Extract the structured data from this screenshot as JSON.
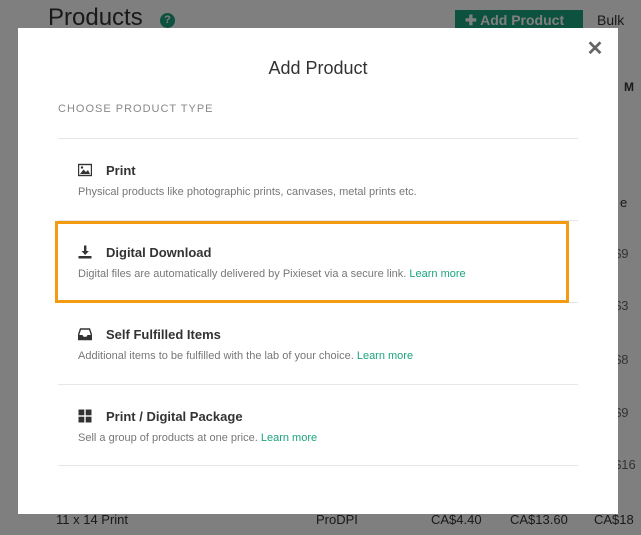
{
  "background": {
    "page_title": "Products",
    "help_icon": "?",
    "add_product_label": "Add Product",
    "bulk_label": "Bulk",
    "column_header": "M",
    "column_fragment": "e",
    "side_values": [
      "$9",
      "$3",
      "$8",
      "$9",
      "$16"
    ],
    "last_row": {
      "name": "11 x 14 Print",
      "lab": "ProDPI",
      "cost": "CA$4.40",
      "price": "CA$13.60",
      "extra": "CA$18"
    }
  },
  "modal": {
    "title": "Add Product",
    "close_glyph": "✕",
    "section_label": "CHOOSE PRODUCT TYPE",
    "options": [
      {
        "icon": "image-icon",
        "title": "Print",
        "desc": "Physical products like photographic prints, canvases, metal prints etc.",
        "link": ""
      },
      {
        "icon": "download-icon",
        "title": "Digital Download",
        "desc": "Digital files are automatically delivered by Pixieset via a secure link.",
        "link": "Learn more"
      },
      {
        "icon": "inbox-icon",
        "title": "Self Fulfilled Items",
        "desc": "Additional items to be fulfilled with the lab of your choice.",
        "link": "Learn more"
      },
      {
        "icon": "grid-icon",
        "title": "Print / Digital Package",
        "desc": "Sell a group of products at one price.",
        "link": "Learn more"
      }
    ]
  },
  "colors": {
    "accent": "#1aa57e",
    "highlight": "#f39c12"
  }
}
